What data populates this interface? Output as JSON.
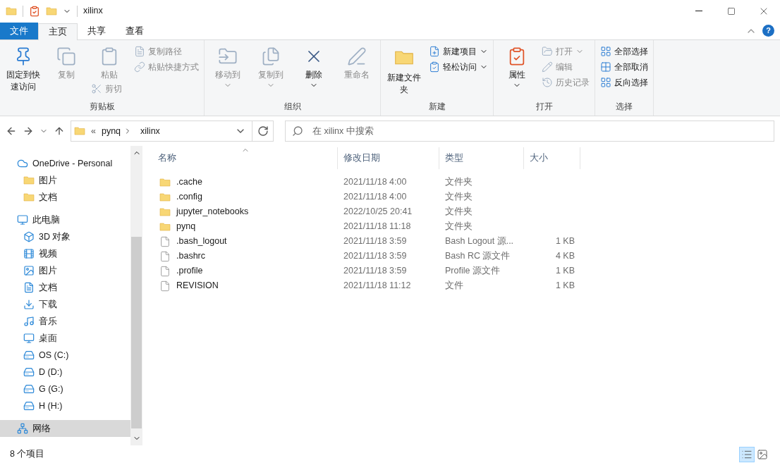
{
  "title_bar": {
    "title": "xilinx"
  },
  "help_button": {
    "label": "?"
  },
  "ribbon": {
    "tabs": [
      {
        "label": "文件",
        "kind": "file",
        "selected": false
      },
      {
        "label": "主页",
        "kind": "tab",
        "selected": true
      },
      {
        "label": "共享",
        "kind": "tab",
        "selected": false
      },
      {
        "label": "查看",
        "kind": "tab",
        "selected": false
      }
    ],
    "groups": [
      {
        "label": "剪贴板",
        "columns": [
          [
            {
              "label": "固定到快速访问",
              "kind": "large",
              "disabled": false,
              "dropdown": false
            }
          ],
          [
            {
              "label": "复制",
              "kind": "large",
              "disabled": true,
              "dropdown": false
            }
          ],
          [
            {
              "label": "粘贴",
              "kind": "large",
              "disabled": true,
              "dropdown": false
            },
            {
              "label": "剪切",
              "kind": "small",
              "disabled": true,
              "dropdown": false
            }
          ],
          [
            {
              "label": "复制路径",
              "kind": "small",
              "disabled": true,
              "dropdown": false
            },
            {
              "label": "粘贴快捷方式",
              "kind": "small",
              "disabled": true,
              "dropdown": false
            }
          ]
        ]
      },
      {
        "label": "组织",
        "columns": [
          [
            {
              "label": "移动到",
              "kind": "large",
              "disabled": true,
              "dropdown": true
            }
          ],
          [
            {
              "label": "复制到",
              "kind": "large",
              "disabled": true,
              "dropdown": true
            }
          ],
          [
            {
              "label": "删除",
              "kind": "large",
              "disabled": false,
              "dropdown": true
            }
          ],
          [
            {
              "label": "重命名",
              "kind": "large",
              "disabled": true,
              "dropdown": false
            }
          ]
        ]
      },
      {
        "label": "新建",
        "columns": [
          [
            {
              "label": "新建文件夹",
              "kind": "large",
              "disabled": false,
              "dropdown": false
            }
          ],
          [
            {
              "label": "新建项目",
              "kind": "small",
              "disabled": false,
              "dropdown": true
            },
            {
              "label": "轻松访问",
              "kind": "small",
              "disabled": false,
              "dropdown": true
            }
          ]
        ]
      },
      {
        "label": "打开",
        "columns": [
          [
            {
              "label": "属性",
              "kind": "large",
              "disabled": false,
              "dropdown": true
            }
          ],
          [
            {
              "label": "打开",
              "kind": "small",
              "disabled": true,
              "dropdown": true
            },
            {
              "label": "编辑",
              "kind": "small",
              "disabled": true,
              "dropdown": false
            },
            {
              "label": "历史记录",
              "kind": "small",
              "disabled": true,
              "dropdown": false
            }
          ]
        ]
      },
      {
        "label": "选择",
        "columns": [
          [
            {
              "label": "全部选择",
              "kind": "small",
              "disabled": false,
              "dropdown": false
            },
            {
              "label": "全部取消",
              "kind": "small",
              "disabled": false,
              "dropdown": false
            },
            {
              "label": "反向选择",
              "kind": "small",
              "disabled": false,
              "dropdown": false
            }
          ]
        ]
      }
    ]
  },
  "address_bar": {
    "overflow": "«",
    "path": [
      "pynq",
      "xilinx"
    ]
  },
  "search": {
    "placeholder": "在 xilinx 中搜索"
  },
  "sidebar": {
    "items": [
      {
        "label": "OneDrive - Personal",
        "selected": false,
        "children": [
          {
            "label": "图片",
            "selected": false
          },
          {
            "label": "文档",
            "selected": false
          }
        ]
      },
      {
        "label": "此电脑",
        "selected": false,
        "children": [
          {
            "label": "3D 对象",
            "selected": false
          },
          {
            "label": "视频",
            "selected": false
          },
          {
            "label": "图片",
            "selected": false
          },
          {
            "label": "文档",
            "selected": false
          },
          {
            "label": "下载",
            "selected": false
          },
          {
            "label": "音乐",
            "selected": false
          },
          {
            "label": "桌面",
            "selected": false
          },
          {
            "label": "OS (C:)",
            "selected": false
          },
          {
            "label": "D (D:)",
            "selected": false
          },
          {
            "label": "G (G:)",
            "selected": false
          },
          {
            "label": "H (H:)",
            "selected": false
          }
        ]
      },
      {
        "label": "网络",
        "selected": true
      }
    ]
  },
  "file_list": {
    "columns": [
      "名称",
      "修改日期",
      "类型",
      "大小"
    ],
    "rows": [
      {
        "kind": "folder",
        "name": ".cache",
        "date": "2021/11/18 4:00",
        "type": "文件夹",
        "size": ""
      },
      {
        "kind": "folder",
        "name": ".config",
        "date": "2021/11/18 4:00",
        "type": "文件夹",
        "size": ""
      },
      {
        "kind": "folder",
        "name": "jupyter_notebooks",
        "date": "2022/10/25 20:41",
        "type": "文件夹",
        "size": ""
      },
      {
        "kind": "folder",
        "name": "pynq",
        "date": "2021/11/18 11:18",
        "type": "文件夹",
        "size": ""
      },
      {
        "kind": "file",
        "name": ".bash_logout",
        "date": "2021/11/18 3:59",
        "type": "Bash Logout 源...",
        "size": "1 KB"
      },
      {
        "kind": "file",
        "name": ".bashrc",
        "date": "2021/11/18 3:59",
        "type": "Bash RC 源文件",
        "size": "4 KB"
      },
      {
        "kind": "file",
        "name": ".profile",
        "date": "2021/11/18 3:59",
        "type": "Profile 源文件",
        "size": "1 KB"
      },
      {
        "kind": "file",
        "name": "REVISION",
        "date": "2021/11/18 11:12",
        "type": "文件",
        "size": "1 KB"
      }
    ]
  },
  "status_bar": {
    "item_count": "8 个项目",
    "view_buttons": [
      {
        "kind": "details",
        "selected": true
      },
      {
        "kind": "large_icons",
        "selected": false
      }
    ]
  }
}
